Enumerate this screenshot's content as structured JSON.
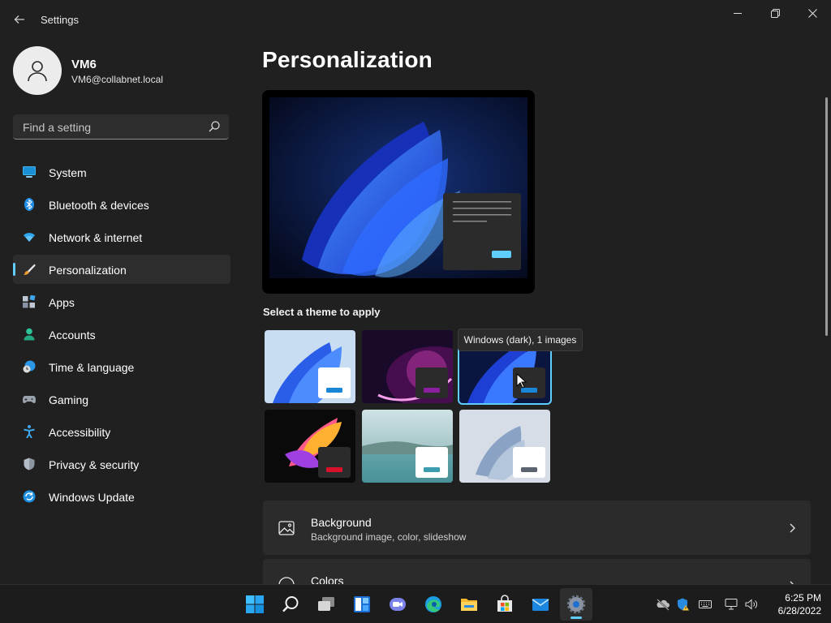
{
  "window": {
    "title": "Settings",
    "back_icon": "back-arrow-icon",
    "controls": [
      "minimize-icon",
      "restore-icon",
      "close-icon"
    ]
  },
  "profile": {
    "name": "VM6",
    "email": "VM6@collabnet.local"
  },
  "search": {
    "placeholder": "Find a setting",
    "value": ""
  },
  "nav": {
    "items": [
      {
        "label": "System",
        "icon": "system-icon"
      },
      {
        "label": "Bluetooth & devices",
        "icon": "bluetooth-icon"
      },
      {
        "label": "Network & internet",
        "icon": "wifi-icon"
      },
      {
        "label": "Personalization",
        "icon": "brush-icon",
        "active": true
      },
      {
        "label": "Apps",
        "icon": "apps-icon"
      },
      {
        "label": "Accounts",
        "icon": "accounts-icon"
      },
      {
        "label": "Time & language",
        "icon": "clock-globe-icon"
      },
      {
        "label": "Gaming",
        "icon": "gamepad-icon"
      },
      {
        "label": "Accessibility",
        "icon": "accessibility-icon"
      },
      {
        "label": "Privacy & security",
        "icon": "shield-icon"
      },
      {
        "label": "Windows Update",
        "icon": "update-icon"
      }
    ]
  },
  "main": {
    "title": "Personalization",
    "themes_label": "Select a theme to apply",
    "tooltip": "Windows (dark), 1 images",
    "themes": [
      {
        "id": "windows-light",
        "selected": false
      },
      {
        "id": "glow",
        "selected": false
      },
      {
        "id": "windows-dark",
        "selected": true
      },
      {
        "id": "captured-motion",
        "selected": false
      },
      {
        "id": "sunrise",
        "selected": false
      },
      {
        "id": "flow",
        "selected": false
      }
    ],
    "cards": [
      {
        "title": "Background",
        "subtitle": "Background image, color, slideshow",
        "icon": "image-icon"
      },
      {
        "title": "Colors",
        "subtitle": "",
        "icon": "palette-icon"
      }
    ]
  },
  "taskbar": {
    "apps": [
      "start-icon",
      "search-icon",
      "task-view-icon",
      "widgets-icon",
      "teams-chat-icon",
      "edge-icon",
      "file-explorer-icon",
      "store-icon",
      "mail-icon",
      "settings-icon"
    ],
    "active_app": "settings-icon",
    "tray": [
      "onedrive-offline-icon",
      "defender-warning-icon",
      "keyboard-icon",
      "network-icon",
      "volume-icon"
    ],
    "time": "6:25 PM",
    "date": "6/28/2022"
  },
  "colors": {
    "accent": "#60cdff",
    "background": "#202020",
    "card": "#2b2b2b"
  }
}
